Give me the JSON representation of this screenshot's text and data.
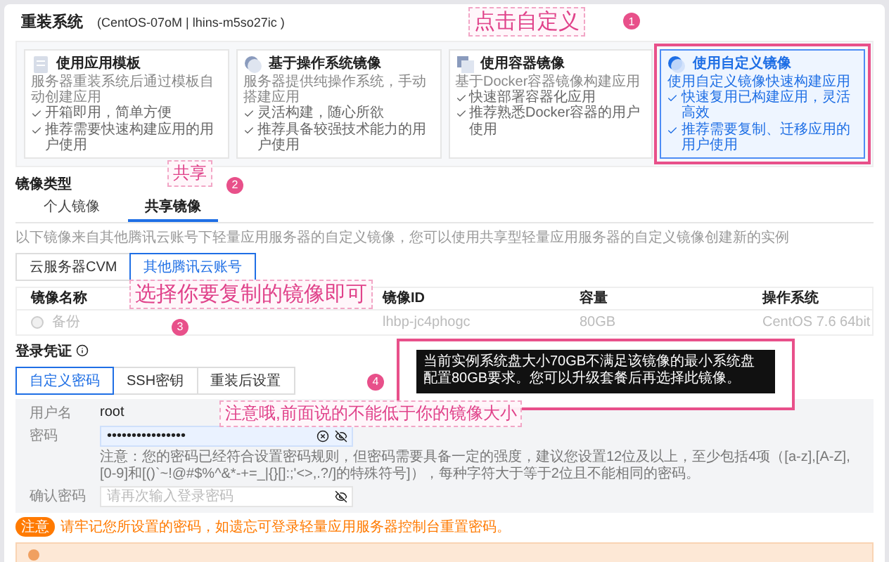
{
  "dialog": {
    "title": "重装系统",
    "subtitle": "(CentOS-07oM | lhins-m5so27ic )"
  },
  "image_sources": [
    {
      "kind": "template",
      "title": "使用应用模板",
      "description": "服务器重装系统后通过模板自动创建应用",
      "features": [
        "开箱即用，简单方便",
        "推荐需要快速构建应用的用户使用"
      ],
      "selected": false
    },
    {
      "kind": "os",
      "title": "基于操作系统镜像",
      "description": "服务器提供纯操作系统，手动搭建应用",
      "features": [
        "灵活构建，随心所欲",
        "推荐具备较强技术能力的用户使用"
      ],
      "selected": false
    },
    {
      "kind": "container",
      "title": "使用容器镜像",
      "description": "基于Docker容器镜像构建应用",
      "features": [
        "快速部署容器化应用",
        "推荐熟悉Docker容器的用户使用"
      ],
      "selected": false
    },
    {
      "kind": "custom",
      "title": "使用自定义镜像",
      "description": "使用自定义镜像快速构建应用",
      "features": [
        "快速复用已构建应用，灵活高效",
        "推荐需要复制、迁移应用的用户使用"
      ],
      "selected": true
    }
  ],
  "image_type": {
    "label": "镜像类型",
    "tabs": [
      {
        "label": "个人镜像",
        "selected": false
      },
      {
        "label": "共享镜像",
        "selected": true
      }
    ],
    "description": "以下镜像来自其他腾讯云账号下轻量应用服务器的自定义镜像，您可以使用共享型轻量应用服务器的自定义镜像创建新的实例",
    "source_buttons": [
      {
        "label": "云服务器CVM",
        "selected": false
      },
      {
        "label": "其他腾讯云账号",
        "selected": true
      }
    ]
  },
  "table": {
    "columns": [
      "镜像名称",
      "镜像ID",
      "容量",
      "操作系统"
    ],
    "rows": [
      {
        "name": "备份",
        "id": "lhbp-jc4phogc",
        "capacity": "80GB",
        "os": "CentOS 7.6 64bit",
        "disabled": true,
        "selected": false
      }
    ]
  },
  "tooltip": {
    "text": "当前实例系统盘大小70GB不满足该镜像的最小系统盘配置80GB要求。您可以升级套餐后再选择此镜像。"
  },
  "login": {
    "label": "登录凭证",
    "tabs": [
      {
        "label": "自定义密码",
        "selected": true
      },
      {
        "label": "SSH密钥",
        "selected": false
      },
      {
        "label": "重装后设置",
        "selected": false
      }
    ],
    "username_label": "用户名",
    "username": "root",
    "password_label": "密码",
    "password_value": "••••••••••••••••",
    "password_note": "注意：您的密码已经符合设置密码规则，但密码需要具备一定的强度，建议您设置12位及以上，至少包括4项（[a-z],[A-Z],[0-9]和[()`~!@#$%^&*-+=_|{}[]:;'<>,.?/]的特殊符号]），每种字符大于等于2位且不能相同的密码。",
    "confirm_label": "确认密码",
    "confirm_placeholder": "请再次输入登录密码"
  },
  "warning": {
    "tag": "注意",
    "text": "请牢记您所设置的密码，如遗忘可登录轻量应用服务器控制台重置密码。"
  },
  "annotations": [
    {
      "number": "1",
      "text": "点击自定义"
    },
    {
      "number": "2",
      "text": "共享"
    },
    {
      "number": "3",
      "text": "选择你要复制的镜像即可"
    },
    {
      "number": "4",
      "text": "注意哦,前面说的不能低于你的镜像大小"
    }
  ]
}
